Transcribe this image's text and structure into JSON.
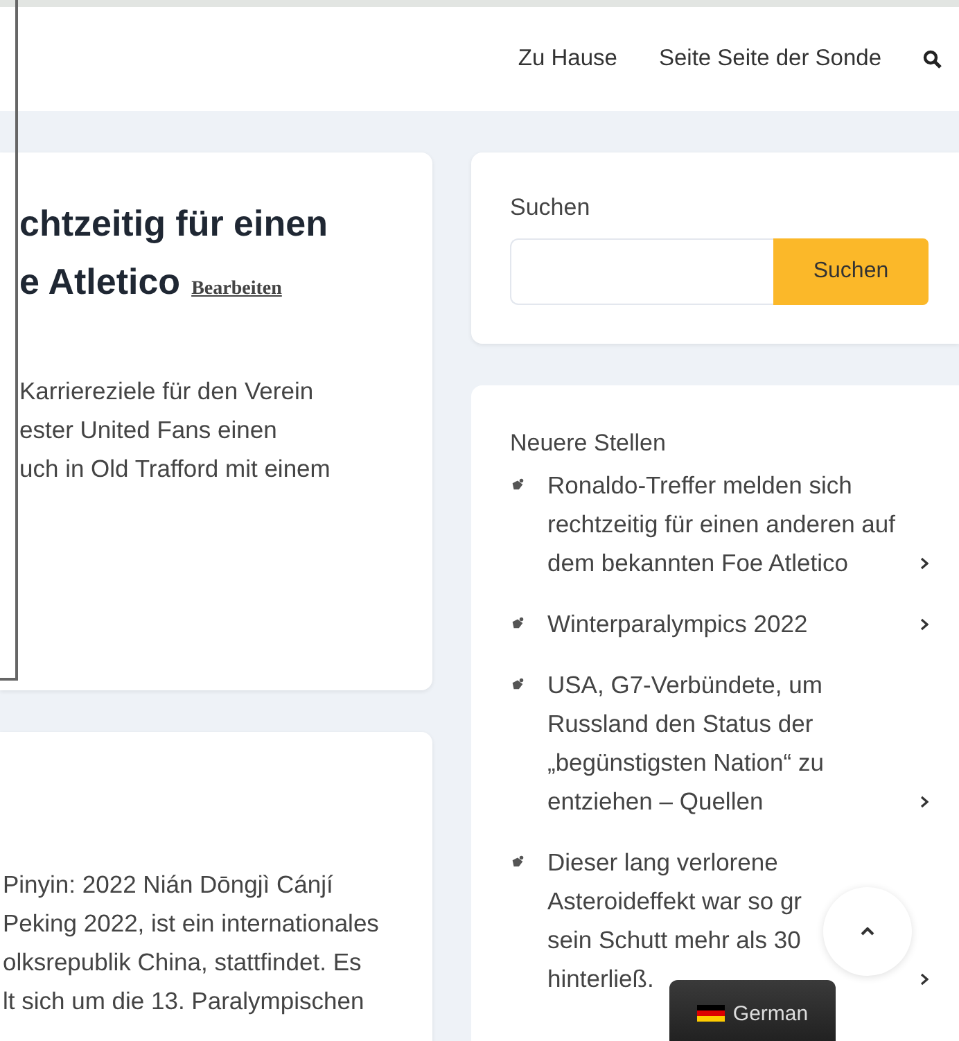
{
  "nav": {
    "links": [
      "Zu Hause",
      "Seite Seite der Sonde"
    ]
  },
  "article": {
    "title_lines": [
      "chtzeitig für einen",
      "e Atletico"
    ],
    "edit_link": "Bearbeiten",
    "body_lines": [
      "Karriereziele für den Verein",
      "ester United Fans einen",
      "uch in Old Trafford mit einem"
    ]
  },
  "article_2": {
    "body_lines": [
      "Pinyin: 2022 Nián Dōngjì Cánjí",
      "Peking 2022, ist ein internationales",
      "olksrepublik China, stattfindet. Es",
      "lt sich um die 13. Paralympischen"
    ]
  },
  "search_widget": {
    "label": "Suchen",
    "button": "Suchen"
  },
  "recent_posts": {
    "title": "Neuere Stellen",
    "items": [
      {
        "lines": [
          "Ronaldo-Treffer melden sich",
          "rechtzeitig für einen anderen auf",
          "dem bekannten Foe Atletico"
        ]
      },
      {
        "lines": [
          "Winterparalympics 2022"
        ]
      },
      {
        "lines": [
          "USA, G7-Verbündete, um",
          "Russland den Status der",
          "„begünstigsten Nation“ zu",
          "entziehen – Quellen"
        ]
      },
      {
        "lines": [
          "Dieser lang verlorene",
          "Asteroideffekt war so gr",
          "sein Schutt mehr als 30",
          "hinterließ."
        ]
      }
    ]
  },
  "language_badge": {
    "label": "German"
  }
}
